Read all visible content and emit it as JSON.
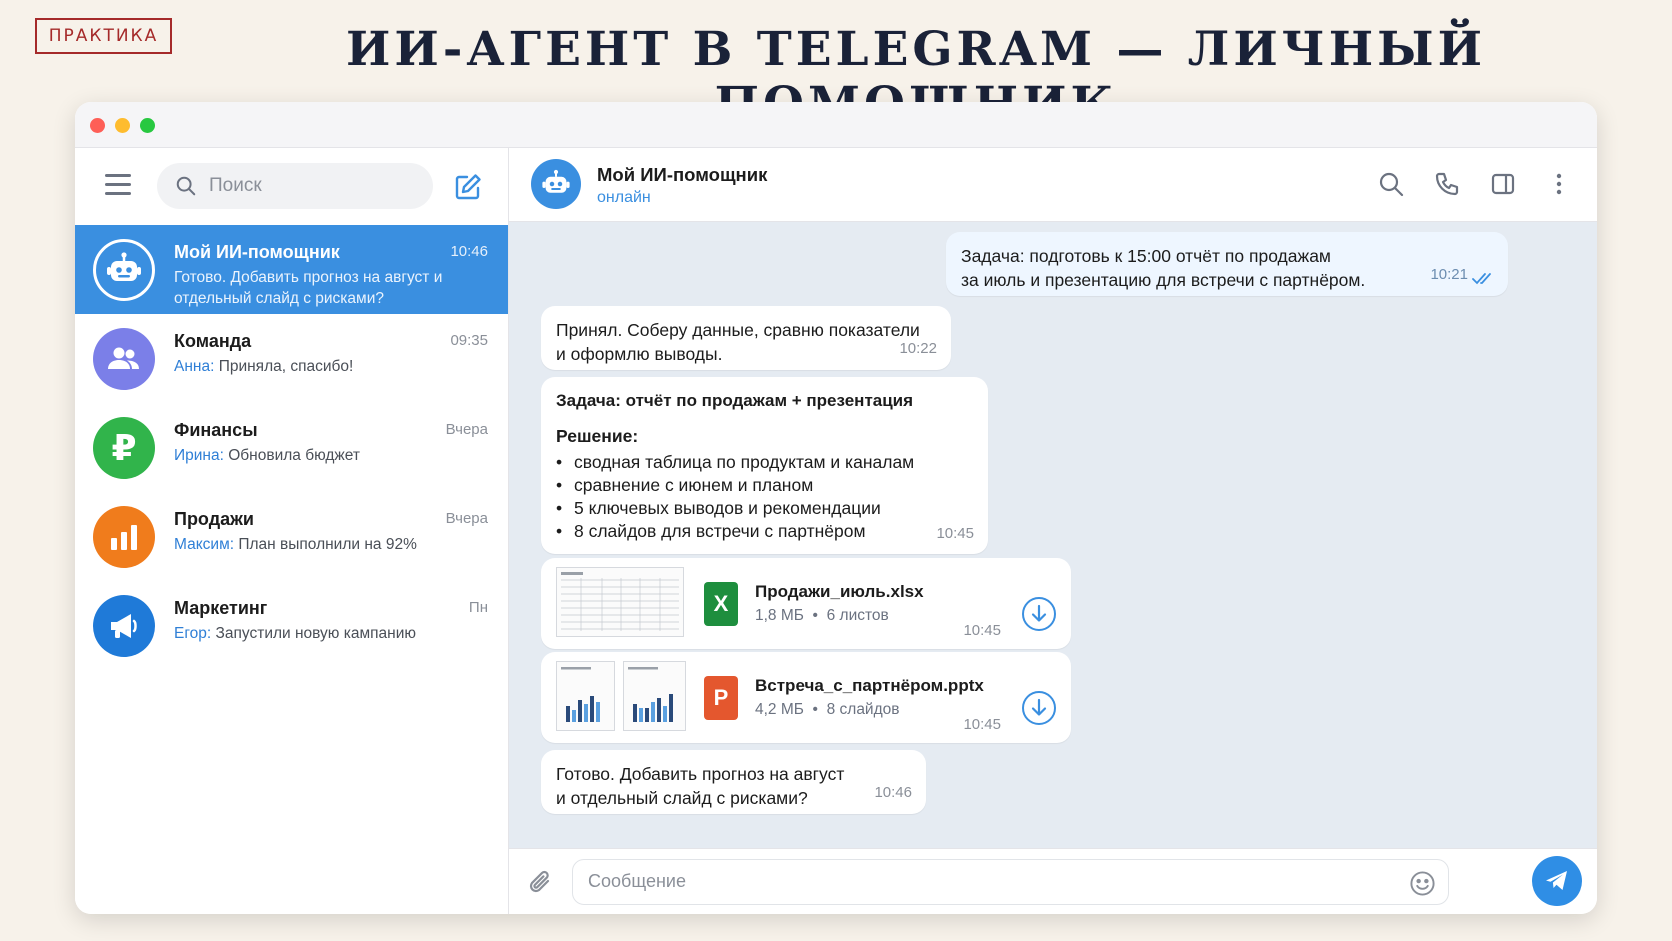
{
  "slide": {
    "tag": "ПРАКТИКА",
    "headline": "ИИ-АГЕНТ В TELEGRAM — ЛИЧНЫЙ ПОМОЩНИК"
  },
  "sidebar": {
    "search_placeholder": "Поиск",
    "chats": [
      {
        "name": "Мой ИИ-помощник",
        "time": "10:46",
        "sender": "",
        "preview": "Готово. Добавить прогноз на август и отдельный слайд с рисками?",
        "avatar_color": "#3a8fe0",
        "icon": "robot-icon"
      },
      {
        "name": "Команда",
        "time": "09:35",
        "sender": "Анна:",
        "preview": "Приняла, спасибо!",
        "avatar_color": "#7b7fe8",
        "icon": "group-icon"
      },
      {
        "name": "Финансы",
        "time": "Вчера",
        "sender": "Ирина:",
        "preview": "Обновила бюджет",
        "avatar_color": "#31b44b",
        "icon": "ruble-icon"
      },
      {
        "name": "Продажи",
        "time": "Вчера",
        "sender": "Максим:",
        "preview": "План выполнили на 92%",
        "avatar_color": "#f07c1c",
        "icon": "bar-chart-icon"
      },
      {
        "name": "Маркетинг",
        "time": "Пн",
        "sender": "Егор:",
        "preview": "Запустили новую кампанию",
        "avatar_color": "#1f7ad8",
        "icon": "megaphone-icon"
      }
    ]
  },
  "chat": {
    "title": "Мой ИИ-помощник",
    "status": "онлайн",
    "messages": {
      "m1": {
        "line1": "Задача: подготовь к 15:00 отчёт по продажам",
        "line2": "за июль и презентацию для встречи с партнёром.",
        "time": "10:21"
      },
      "m2": {
        "line1": "Принял. Соберу данные, сравню показатели",
        "line2": "и оформлю выводы.",
        "time": "10:22"
      },
      "m3": {
        "title": "Задача: отчёт по продажам + презентация",
        "subtitle": "Решение:",
        "bullets": [
          "сводная таблица по продуктам и каналам",
          "сравнение с июнем и планом",
          "5 ключевых выводов и рекомендации",
          "8 слайдов для встречи с партнёром"
        ],
        "time": "10:45"
      },
      "file1": {
        "name": "Продажи_июль.xlsx",
        "size": "1,8 МБ",
        "detail": "6 листов",
        "time": "10:45",
        "icon_letter": "X",
        "icon_color": "#1e8e3e"
      },
      "file2": {
        "name": "Встреча_с_партнёром.pptx",
        "size": "4,2 МБ",
        "detail": "8 слайдов",
        "time": "10:45",
        "icon_letter": "P",
        "icon_color": "#e4572e"
      },
      "m4": {
        "line1": "Готово. Добавить прогноз на август",
        "line2": "и отдельный слайд с рисками?",
        "time": "10:46"
      }
    },
    "composer_placeholder": "Сообщение"
  }
}
